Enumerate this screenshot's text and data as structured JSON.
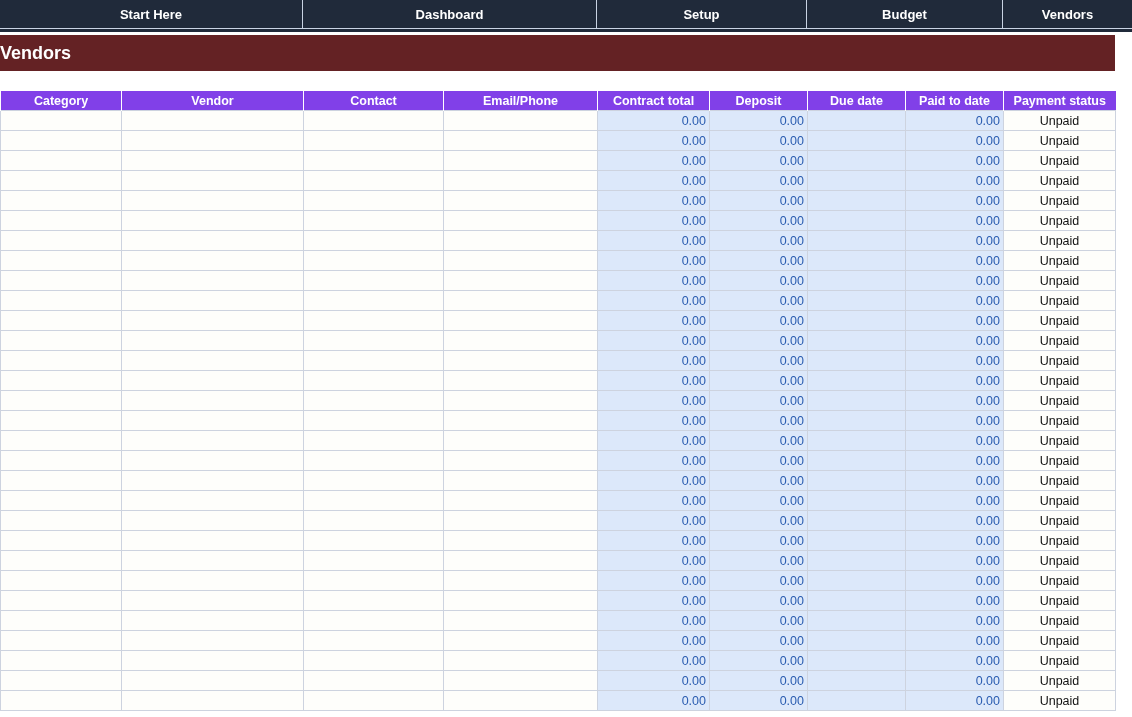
{
  "nav_tabs": [
    {
      "label": "Start Here"
    },
    {
      "label": "Dashboard"
    },
    {
      "label": "Setup"
    },
    {
      "label": "Budget"
    },
    {
      "label": "Vendors"
    }
  ],
  "title": "Vendors",
  "table": {
    "columns": [
      "Category",
      "Vendor",
      "Contact",
      "Email/Phone",
      "Contract total",
      "Deposit",
      "Due date",
      "Paid to date",
      "Payment status"
    ],
    "rows": [
      {
        "contract_total": "0.00",
        "deposit": "0.00",
        "paid_to_date": "0.00",
        "payment_status": "Unpaid"
      },
      {
        "contract_total": "0.00",
        "deposit": "0.00",
        "paid_to_date": "0.00",
        "payment_status": "Unpaid"
      },
      {
        "contract_total": "0.00",
        "deposit": "0.00",
        "paid_to_date": "0.00",
        "payment_status": "Unpaid"
      },
      {
        "contract_total": "0.00",
        "deposit": "0.00",
        "paid_to_date": "0.00",
        "payment_status": "Unpaid"
      },
      {
        "contract_total": "0.00",
        "deposit": "0.00",
        "paid_to_date": "0.00",
        "payment_status": "Unpaid"
      },
      {
        "contract_total": "0.00",
        "deposit": "0.00",
        "paid_to_date": "0.00",
        "payment_status": "Unpaid"
      },
      {
        "contract_total": "0.00",
        "deposit": "0.00",
        "paid_to_date": "0.00",
        "payment_status": "Unpaid"
      },
      {
        "contract_total": "0.00",
        "deposit": "0.00",
        "paid_to_date": "0.00",
        "payment_status": "Unpaid"
      },
      {
        "contract_total": "0.00",
        "deposit": "0.00",
        "paid_to_date": "0.00",
        "payment_status": "Unpaid"
      },
      {
        "contract_total": "0.00",
        "deposit": "0.00",
        "paid_to_date": "0.00",
        "payment_status": "Unpaid"
      },
      {
        "contract_total": "0.00",
        "deposit": "0.00",
        "paid_to_date": "0.00",
        "payment_status": "Unpaid"
      },
      {
        "contract_total": "0.00",
        "deposit": "0.00",
        "paid_to_date": "0.00",
        "payment_status": "Unpaid"
      },
      {
        "contract_total": "0.00",
        "deposit": "0.00",
        "paid_to_date": "0.00",
        "payment_status": "Unpaid"
      },
      {
        "contract_total": "0.00",
        "deposit": "0.00",
        "paid_to_date": "0.00",
        "payment_status": "Unpaid"
      },
      {
        "contract_total": "0.00",
        "deposit": "0.00",
        "paid_to_date": "0.00",
        "payment_status": "Unpaid"
      },
      {
        "contract_total": "0.00",
        "deposit": "0.00",
        "paid_to_date": "0.00",
        "payment_status": "Unpaid"
      },
      {
        "contract_total": "0.00",
        "deposit": "0.00",
        "paid_to_date": "0.00",
        "payment_status": "Unpaid"
      },
      {
        "contract_total": "0.00",
        "deposit": "0.00",
        "paid_to_date": "0.00",
        "payment_status": "Unpaid"
      },
      {
        "contract_total": "0.00",
        "deposit": "0.00",
        "paid_to_date": "0.00",
        "payment_status": "Unpaid"
      },
      {
        "contract_total": "0.00",
        "deposit": "0.00",
        "paid_to_date": "0.00",
        "payment_status": "Unpaid"
      },
      {
        "contract_total": "0.00",
        "deposit": "0.00",
        "paid_to_date": "0.00",
        "payment_status": "Unpaid"
      },
      {
        "contract_total": "0.00",
        "deposit": "0.00",
        "paid_to_date": "0.00",
        "payment_status": "Unpaid"
      },
      {
        "contract_total": "0.00",
        "deposit": "0.00",
        "paid_to_date": "0.00",
        "payment_status": "Unpaid"
      },
      {
        "contract_total": "0.00",
        "deposit": "0.00",
        "paid_to_date": "0.00",
        "payment_status": "Unpaid"
      },
      {
        "contract_total": "0.00",
        "deposit": "0.00",
        "paid_to_date": "0.00",
        "payment_status": "Unpaid"
      },
      {
        "contract_total": "0.00",
        "deposit": "0.00",
        "paid_to_date": "0.00",
        "payment_status": "Unpaid"
      },
      {
        "contract_total": "0.00",
        "deposit": "0.00",
        "paid_to_date": "0.00",
        "payment_status": "Unpaid"
      },
      {
        "contract_total": "0.00",
        "deposit": "0.00",
        "paid_to_date": "0.00",
        "payment_status": "Unpaid"
      },
      {
        "contract_total": "0.00",
        "deposit": "0.00",
        "paid_to_date": "0.00",
        "payment_status": "Unpaid"
      },
      {
        "contract_total": "0.00",
        "deposit": "0.00",
        "paid_to_date": "0.00",
        "payment_status": "Unpaid"
      }
    ]
  }
}
